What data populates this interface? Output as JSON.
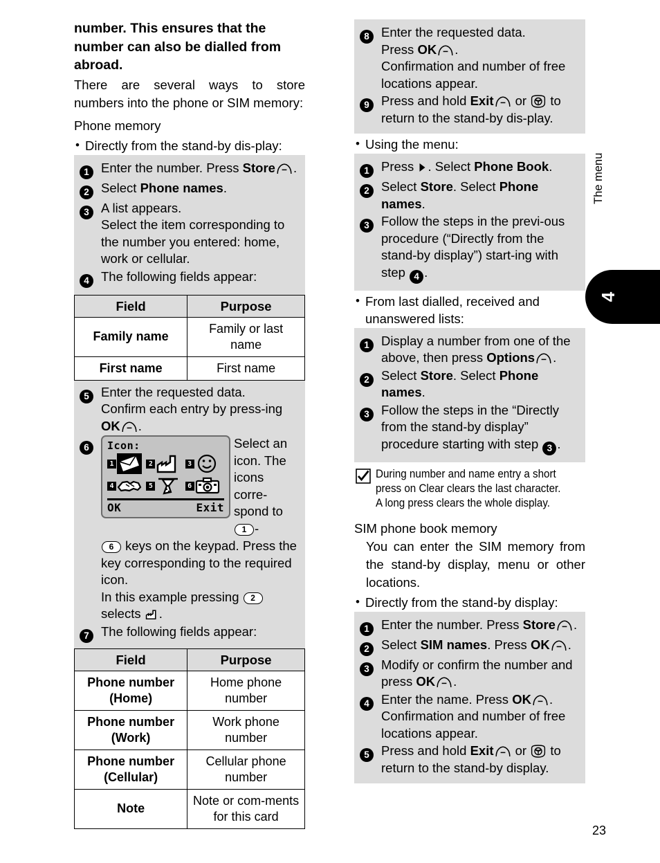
{
  "page": {
    "number": "23",
    "margin_tab_number": "4",
    "margin_tab_label": "The menu"
  },
  "left_column": {
    "heading": "number. This ensures that the number can also be dialled from abroad.",
    "intro": "There are several ways to store numbers into the phone or SIM memory:",
    "section_title": "Phone memory",
    "bullet_standby": "Directly from the stand-by dis-play:",
    "steps_standby": [
      {
        "num": "1",
        "pre": "Enter the number. Press ",
        "bold": "Store",
        "icon": "softkey-icon",
        "post": "."
      },
      {
        "num": "2",
        "pre": "Select ",
        "bold": "Phone names",
        "post": "."
      },
      {
        "num": "3",
        "text": "A list appears.\nSelect the item corresponding to the number you entered: home, work or cellular."
      },
      {
        "num": "4",
        "text": "The following fields appear:"
      }
    ],
    "table_names": {
      "headers": [
        "Field",
        "Purpose"
      ],
      "rows": [
        [
          "Family name",
          "Family or last name"
        ],
        [
          "First name",
          "First name"
        ]
      ]
    },
    "step5": {
      "num": "5",
      "line1": "Enter the requested data.",
      "line2_pre": "Confirm each entry by press-ing ",
      "line2_bold": "OK",
      "line2_icon": "softkey-icon",
      "line2_post": "."
    },
    "step6": {
      "num": "6",
      "side_text": "Select an icon. The icons corre-spond to",
      "side_key_from": "1",
      "side_dash": "-",
      "after_key_to": "6",
      "after_text": "keys on the keypad. Press the key corresponding to the required icon.",
      "example_pre": "In this example pressing",
      "example_key": "2",
      "example_post": "selects",
      "example_icon": "factory-icon",
      "example_end": "."
    },
    "lcd": {
      "title": "Icon:",
      "softkey_left": "OK",
      "softkey_right": "Exit",
      "icons": [
        {
          "badge": "1",
          "name": "envelope-icon",
          "selected": true
        },
        {
          "badge": "2",
          "name": "factory-icon",
          "selected": false
        },
        {
          "badge": "3",
          "name": "smiley-icon",
          "selected": false
        },
        {
          "badge": "4",
          "name": "handshake-icon",
          "selected": false
        },
        {
          "badge": "5",
          "name": "gardening-icon",
          "selected": false
        },
        {
          "badge": "6",
          "name": "camera-icon",
          "selected": false
        }
      ]
    },
    "step7": {
      "num": "7",
      "text": "The following fields appear:"
    },
    "table_numbers": {
      "headers": [
        "Field",
        "Purpose"
      ],
      "rows": [
        [
          "Phone number (Home)",
          "Home phone number"
        ],
        [
          "Phone number (Work)",
          "Work phone number"
        ],
        [
          "Phone number (Cellular)",
          "Cellular phone number"
        ],
        [
          "Note",
          "Note or com-ments for this card"
        ]
      ]
    }
  },
  "right_column": {
    "steps_top": [
      {
        "num": "8",
        "line1": "Enter the requested data.",
        "line2_pre": "Press ",
        "line2_bold": "OK",
        "line2_icon": "softkey-icon",
        "line2_post": ".",
        "line3": "Confirmation and number of free locations appear."
      },
      {
        "num": "9",
        "pre": "Press and hold ",
        "bold": "Exit",
        "icon1": "softkey-icon",
        "mid": " or ",
        "icon2": "end-call-key-icon",
        "post": " to return to the stand-by dis-play."
      }
    ],
    "bullet_menu": "Using the menu:",
    "steps_menu": [
      {
        "num": "1",
        "pre": "Press ",
        "icon": "nav-right-icon",
        "mid": ". Select ",
        "bold": "Phone Book",
        "post": "."
      },
      {
        "num": "2",
        "pre": "Select ",
        "bold1": "Store",
        "mid": ". Select ",
        "bold2": "Phone names",
        "post": "."
      },
      {
        "num": "3",
        "pre": "Follow the steps in the previ-ous procedure (“Directly from the stand-by display”) start-ing with step ",
        "step_ref": "4",
        "post": "."
      }
    ],
    "bullet_lists": "From last dialled, received and unanswered lists:",
    "steps_lists": [
      {
        "num": "1",
        "pre": "Display a number from one of the above, then press ",
        "bold": "Options",
        "icon": "softkey-icon",
        "post": "."
      },
      {
        "num": "2",
        "pre": "Select ",
        "bold1": "Store",
        "mid": ". Select ",
        "bold2": "Phone names",
        "post": "."
      },
      {
        "num": "3",
        "pre": "Follow the steps in the “Directly from the stand-by display” procedure starting with step ",
        "step_ref": "3",
        "post": "."
      }
    ],
    "note": {
      "icon": "tick-icon",
      "text": "During number and name entry a short press on Clear clears the last character. A long press clears the whole display."
    },
    "sim_section_title": "SIM phone book memory",
    "sim_intro": "You can enter the SIM memory from the stand-by display, menu or other locations.",
    "bullet_sim_standby": "Directly from the stand-by display:",
    "steps_sim": [
      {
        "num": "1",
        "pre": "Enter the number. Press ",
        "bold": "Store",
        "icon": "softkey-icon",
        "post": "."
      },
      {
        "num": "2",
        "pre": "Select ",
        "bold1": "SIM names",
        "mid": ". Press ",
        "bold2": "OK",
        "icon": "softkey-icon",
        "post": "."
      },
      {
        "num": "3",
        "pre": "Modify or confirm the number and press ",
        "bold": "OK",
        "icon": "softkey-icon",
        "post": "."
      },
      {
        "num": "4",
        "pre": "Enter the name. Press ",
        "bold": "OK",
        "icon": "softkey-icon",
        "post": ".",
        "line2": "Confirmation and number of free locations appear."
      },
      {
        "num": "5",
        "pre": "Press and hold ",
        "bold": "Exit",
        "icon1": "softkey-icon",
        "mid": " or ",
        "icon2": "end-call-key-icon",
        "post": " to return to the stand-by display."
      }
    ]
  },
  "colors": {
    "box_gray": "#dcdcdc",
    "lcd_gray": "#c4c4c4",
    "lcd_border": "#6b6b6b",
    "ink": "#000000"
  }
}
